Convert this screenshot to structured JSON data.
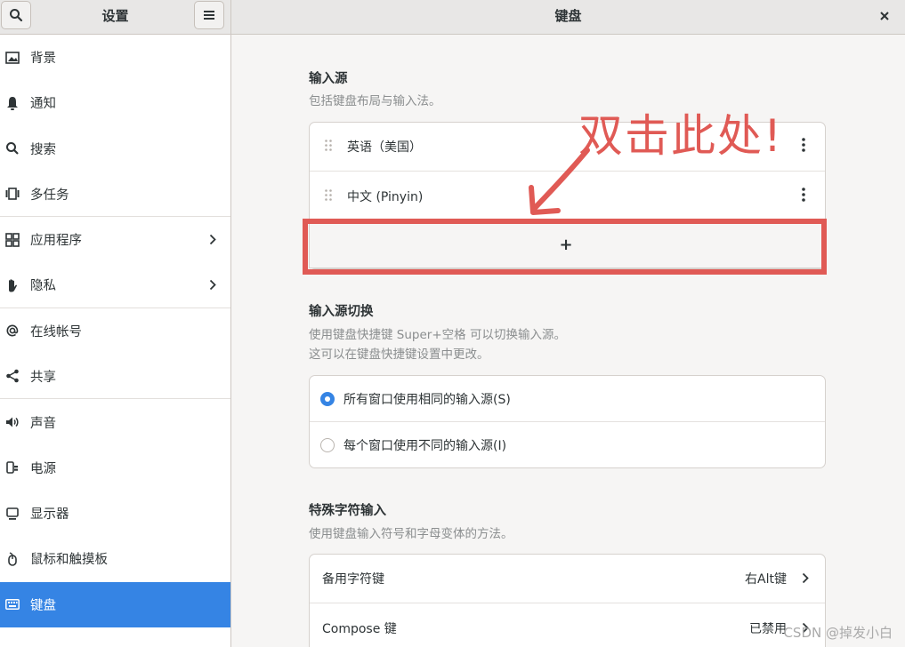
{
  "header": {
    "left_title": "设置",
    "right_title": "键盘"
  },
  "sidebar": {
    "items": [
      {
        "label": "背景",
        "icon": "background-icon"
      },
      {
        "label": "通知",
        "icon": "bell-icon"
      },
      {
        "label": "搜索",
        "icon": "search-icon"
      },
      {
        "label": "多任务",
        "icon": "multitask-icon"
      },
      {
        "label": "应用程序",
        "icon": "apps-grid-icon"
      },
      {
        "label": "隐私",
        "icon": "hand-icon"
      },
      {
        "label": "在线帐号",
        "icon": "at-icon"
      },
      {
        "label": "共享",
        "icon": "share-icon"
      },
      {
        "label": "声音",
        "icon": "speaker-icon"
      },
      {
        "label": "电源",
        "icon": "power-plug-icon"
      },
      {
        "label": "显示器",
        "icon": "monitor-icon"
      },
      {
        "label": "鼠标和触摸板",
        "icon": "mouse-icon"
      },
      {
        "label": "键盘",
        "icon": "keyboard-icon"
      }
    ]
  },
  "main": {
    "input_sources": {
      "title": "输入源",
      "subtitle": "包括键盘布局与输入法。",
      "items": [
        {
          "label": "英语（美国）"
        },
        {
          "label": "中文 (Pinyin)"
        }
      ],
      "add_label": "+"
    },
    "switching": {
      "title": "输入源切换",
      "subtitle_line1": "使用键盘快捷键 Super+空格 可以切换输入源。",
      "subtitle_line2": "这可以在键盘快捷键设置中更改。",
      "options": [
        {
          "label": "所有窗口使用相同的输入源(S)",
          "selected": true
        },
        {
          "label": "每个窗口使用不同的输入源(I)",
          "selected": false
        }
      ]
    },
    "special_chars": {
      "title": "特殊字符输入",
      "subtitle": "使用键盘输入符号和字母变体的方法。",
      "rows": [
        {
          "label": "备用字符键",
          "value": "右Alt键"
        },
        {
          "label": "Compose 键",
          "value": "已禁用"
        }
      ]
    }
  },
  "annotation": {
    "text": "双击此处!",
    "color": "#e05a55"
  },
  "watermark": "CSDN @掉发小白",
  "colors": {
    "accent": "#3584e4",
    "annotation_red": "#e05a55"
  }
}
